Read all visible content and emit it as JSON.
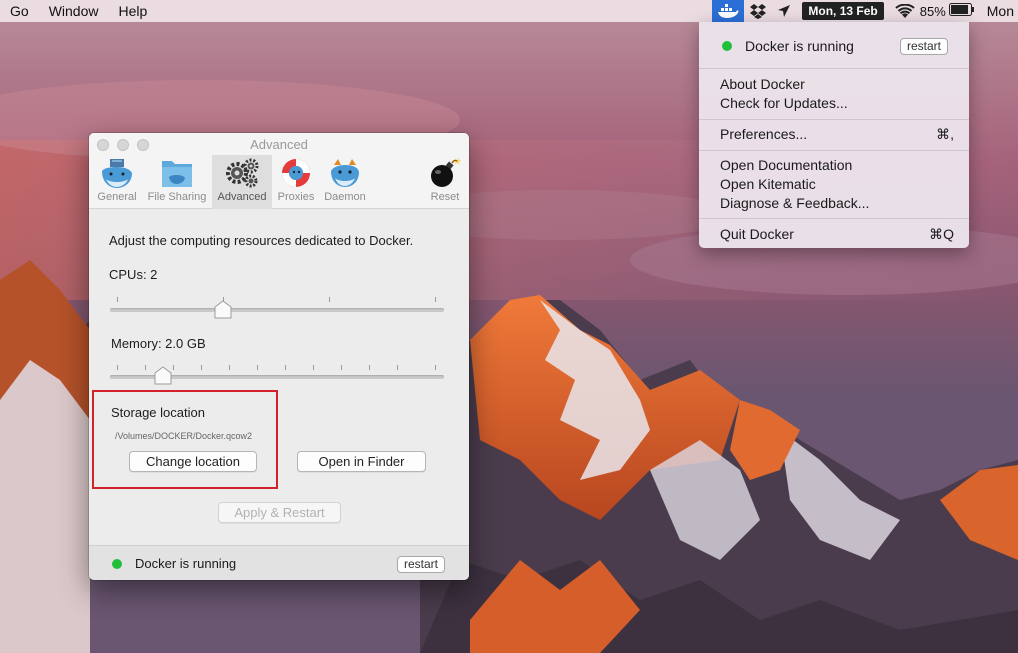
{
  "menubar": {
    "items": [
      "Go",
      "Window",
      "Help"
    ],
    "date": "Mon, 13 Feb",
    "battery": "85%",
    "clock": "Mon"
  },
  "docker_menu": {
    "status": "Docker is running",
    "restart_label": "restart",
    "about": "About Docker",
    "check_updates": "Check for Updates...",
    "preferences": "Preferences...",
    "preferences_shortcut": "⌘,",
    "open_documentation": "Open Documentation",
    "open_kitematic": "Open Kitematic",
    "diagnose": "Diagnose & Feedback...",
    "quit": "Quit Docker",
    "quit_shortcut": "⌘Q"
  },
  "prefs": {
    "title": "Advanced",
    "tabs": [
      {
        "label": "General",
        "icon": "docker-whale-icon"
      },
      {
        "label": "File Sharing",
        "icon": "folder-whale-icon"
      },
      {
        "label": "Advanced",
        "icon": "gears-icon"
      },
      {
        "label": "Proxies",
        "icon": "lifebuoy-whale-icon"
      },
      {
        "label": "Daemon",
        "icon": "whale-daemon-icon"
      },
      {
        "label": "Reset",
        "icon": "bomb-icon"
      }
    ],
    "description": "Adjust the computing resources dedicated to Docker.",
    "cpus_label": "CPUs: 2",
    "cpus_value": 2,
    "cpus_range": [
      1,
      4
    ],
    "memory_label": "Memory: 2.0 GB",
    "memory_value_gb": 2.0,
    "storage_heading": "Storage location",
    "storage_path": "/Volumes/DOCKER/Docker.qcow2",
    "change_location": "Change location",
    "open_in_finder": "Open in Finder",
    "apply_restart": "Apply & Restart",
    "status": "Docker is running",
    "restart_label": "restart"
  },
  "colors": {
    "status_green": "#22c03a",
    "highlight_red": "#d2212a",
    "menu_active_blue": "#2b6fd6"
  }
}
